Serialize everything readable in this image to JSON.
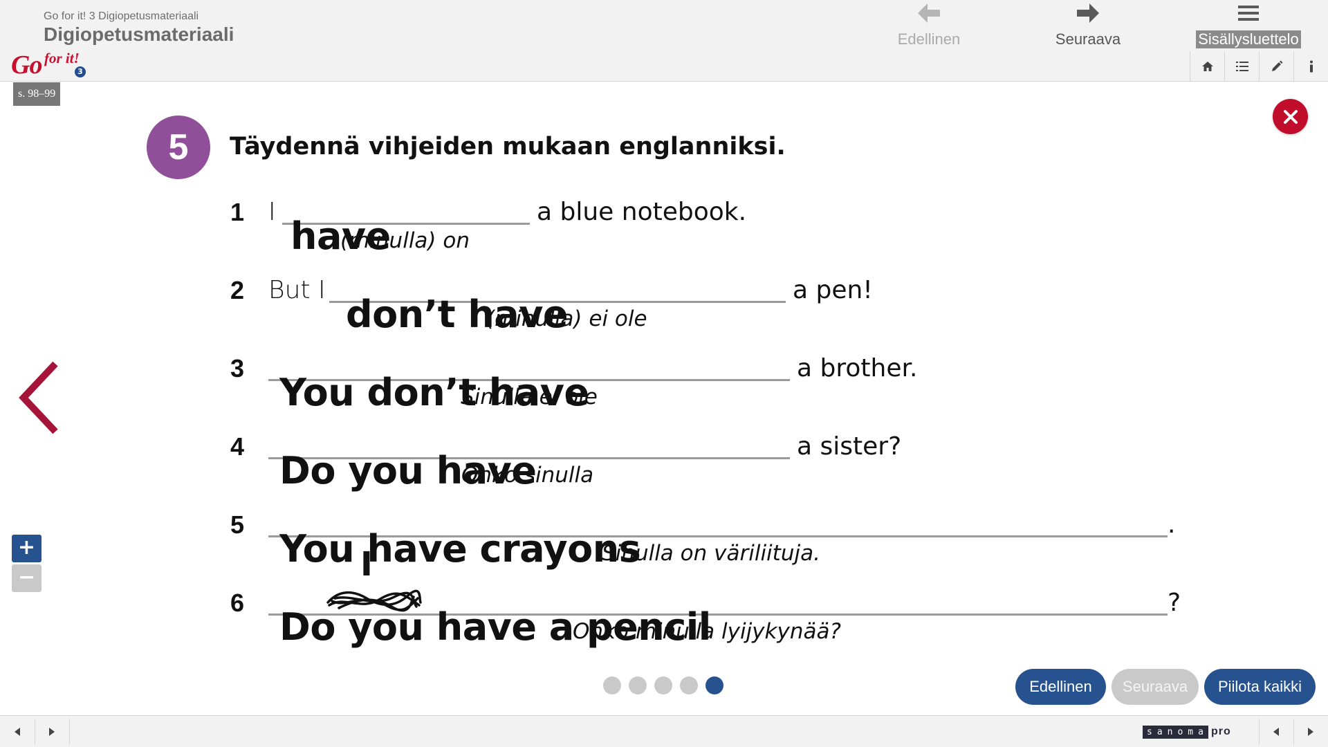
{
  "header": {
    "subtitle": "Go for it! 3 Digiopetusmateriaali",
    "title": "Digiopetusmateriaali",
    "logo_go": "Go",
    "logo_forit": "for it!",
    "logo_number": "3",
    "page_ref": "s. 98–99",
    "nav": {
      "prev_label": "Edellinen",
      "next_label": "Seuraava",
      "toc_label": "Sisällysluettelo"
    },
    "tools": [
      {
        "icon": "home-icon"
      },
      {
        "icon": "list-icon"
      },
      {
        "icon": "pencil-icon"
      },
      {
        "icon": "info-icon"
      }
    ]
  },
  "exercise": {
    "number": "5",
    "instruction": "Täydennä vihjeiden mukaan englanniksi.",
    "items": [
      {
        "num": "1",
        "lead": "I",
        "answer": "have",
        "tail": "a blue notebook.",
        "hint": "(minulla) on"
      },
      {
        "num": "2",
        "lead": "But I",
        "answer": "don’t have",
        "tail": "a pen!",
        "hint": "(minulla) ei ole"
      },
      {
        "num": "3",
        "lead": "",
        "answer": "You don’t have",
        "tail": "a brother.",
        "hint": "Sinulla ei ole"
      },
      {
        "num": "4",
        "lead": "",
        "answer": "Do you have",
        "tail": "a sister?",
        "hint": "Onko sinulla"
      },
      {
        "num": "5",
        "lead": "",
        "answer": "You have crayons",
        "tail": ".",
        "hint": "Sinulla on väriliituja."
      },
      {
        "num": "6",
        "lead": "",
        "answer": "Do you have a pencil",
        "answer_correction": "I",
        "tail": "?",
        "hint": "Onko minulla lyijykynää?"
      }
    ]
  },
  "pagination": {
    "total": 5,
    "current": 5
  },
  "buttons": {
    "prev": "Edellinen",
    "next": "Seuraava",
    "hide_all": "Piilota kaikki"
  },
  "footer": {
    "brand": "sanoma",
    "brand_suffix": "pro"
  },
  "colors": {
    "accent_blue": "#26528f",
    "exercise_purple": "#8f4f99",
    "close_red": "#c00d2c",
    "logo_red": "#c8102e"
  }
}
